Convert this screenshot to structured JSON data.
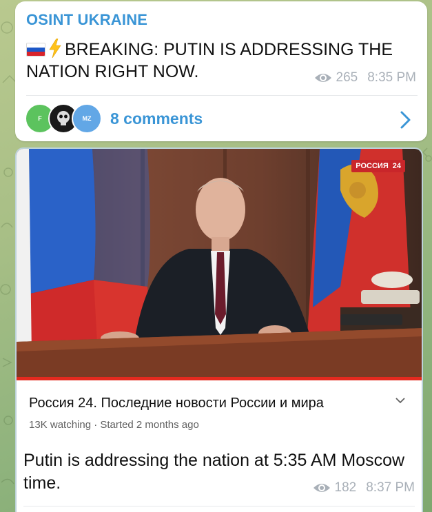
{
  "message1": {
    "channel_name": "OSINT UKRAINE",
    "flag_icon": "russia-flag-icon",
    "bolt_icon": "high-voltage-icon",
    "text": "BREAKING: PUTIN IS ADDRESSING THE NATION RIGHT NOW.",
    "views": "265",
    "time": "8:35 PM",
    "comments": {
      "avatars": [
        "F",
        "",
        "MZ"
      ],
      "label": "8 comments"
    }
  },
  "message2": {
    "video": {
      "watermark_brand": "РОССИЯ",
      "watermark_num": "24",
      "progress": 1.0
    },
    "youtube": {
      "title": "Россия 24. Последние новости России и мира",
      "subtitle": "13K watching · Started 2 months ago"
    },
    "text": "Putin is addressing the nation at 5:35 AM Moscow time.",
    "views": "182",
    "time": "8:37 PM"
  },
  "colors": {
    "accent": "#3a95d6",
    "meta": "#a9b0b8",
    "wallpaper": "#a8bf86"
  }
}
